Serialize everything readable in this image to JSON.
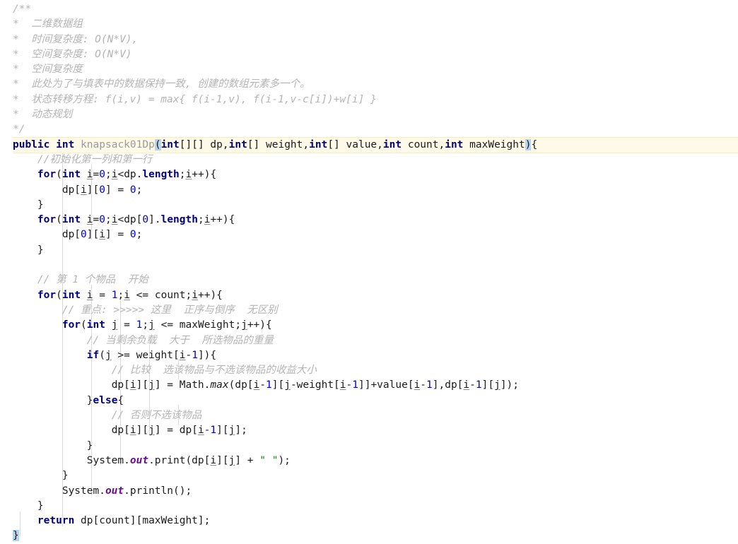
{
  "editor": {
    "language": "Java",
    "theme": "light",
    "colors": {
      "background": "#ffffff",
      "foreground": "#1a1a1a",
      "keyword": "#000080",
      "comment": "#b4b4b4",
      "string": "#1d7324",
      "number": "#0000d0",
      "static_field": "#6a0d91",
      "method_name": "#9a9a9a",
      "caret_line_background": "#fffae8",
      "bracket_match_highlight": "#b6d3f0",
      "indent_guide": "#d8d8dd"
    },
    "caret_line_number": 10,
    "bracket_match_pair": [
      "(",
      ")",
      "}"
    ]
  },
  "code": {
    "javadoc": {
      "open": "/**",
      "lines": [
        "*  二维数据组",
        "*  时间复杂度: O(N*V),",
        "*  空间复杂度: O(N*V)",
        "*  空间复杂度",
        "*  此处为了与填表中的数据保持一致, 创建的数组元素多一个。",
        "*  状态转移方程: f(i,v) = max{ f(i-1,v), f(i-1,v-c[i])+w[i] }",
        "*  动态规划"
      ],
      "close": "*/"
    },
    "signature": {
      "modifier": "public",
      "return_type": "int",
      "method_name": "knapsack01Dp",
      "open_paren": "(",
      "params": "int[][] dp,int[] weight,int[] value,int count,int maxWeight",
      "close_paren": ")",
      "open_brace": "{"
    },
    "comments": {
      "init_row_col": "//初始化第一列和第一行",
      "item_start": "// 第 1 个物品  开始",
      "key_point": "// 重点: >>>>> 这里  正序与倒序  无区别",
      "remaining_load": "// 当剩余负载  大于  所选物品的重量",
      "compare": "// 比较  选该物品与不选该物品的收益大小",
      "else_branch": "// 否则不选该物品"
    },
    "statements": {
      "for_init_rows": "for(int i=0;i<dp.length;i++){",
      "dp_i_0": "dp[i][0] = 0;",
      "for_init_cols": "for(int i=0;i<dp[0].length;i++){",
      "dp_0_i": "dp[0][i] = 0;",
      "for_items": "for(int i = 1;i <= count;i++){",
      "for_weights": "for(int j = 1;j <= maxWeight;j++){",
      "if_cond": "if(j >= weight[i-1]){",
      "dp_assign_max": "dp[i][j] = Math.max(dp[i-1][j-weight[i-1]]+value[i-1],dp[i-1][j]);",
      "else_kw": "}else{",
      "dp_assign_prev": "dp[i][j] = dp[i-1][j];",
      "print": "System.out.print(dp[i][j] + \" \");",
      "println": "System.out.println();",
      "return_stmt": "return dp[count][maxWeight];",
      "close_brace": "}"
    },
    "literals": {
      "zero": "0",
      "one": "1",
      "space_string": "\" \""
    }
  }
}
